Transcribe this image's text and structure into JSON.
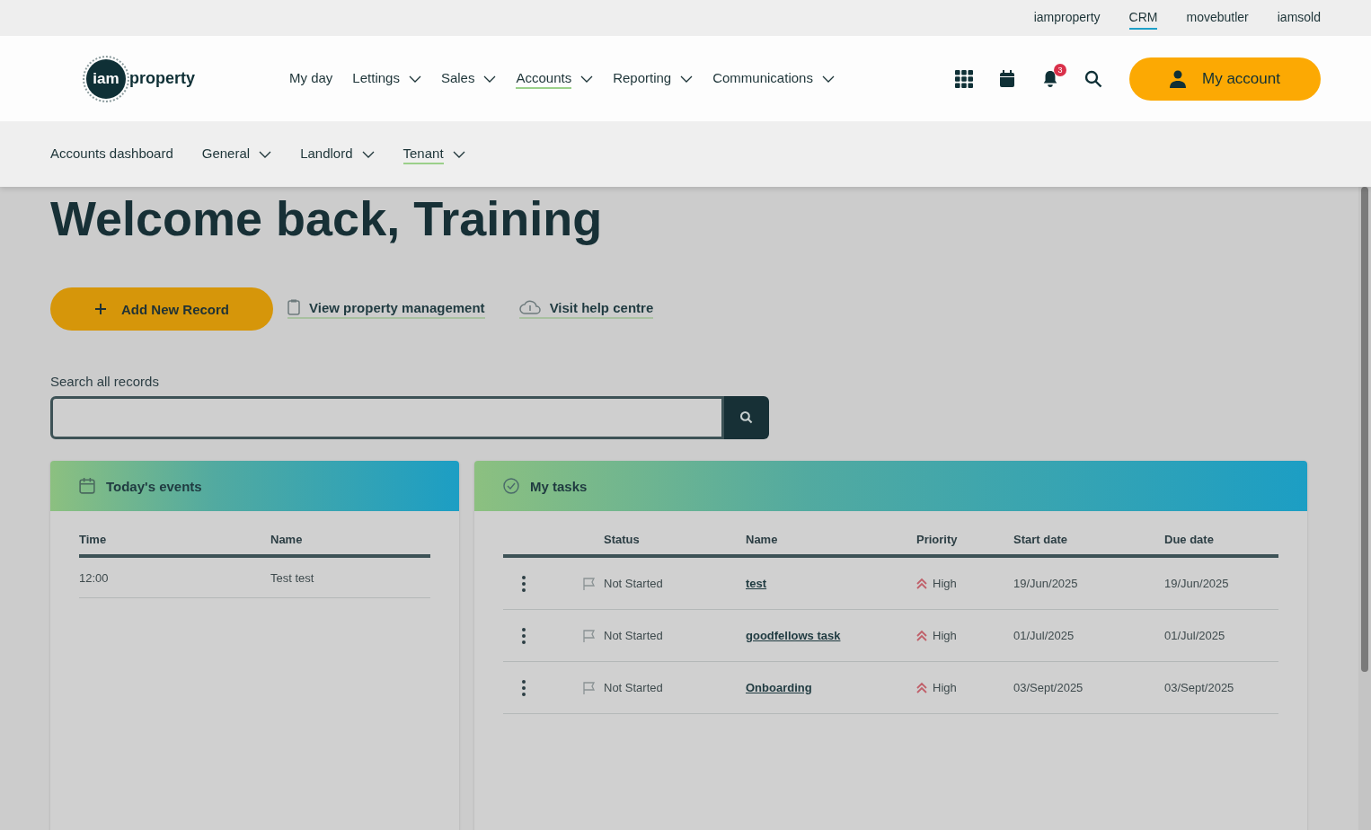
{
  "utility_links": [
    {
      "label": "iamproperty",
      "selected": false
    },
    {
      "label": "CRM",
      "selected": true
    },
    {
      "label": "movebutler",
      "selected": false
    },
    {
      "label": "iamsold",
      "selected": false
    }
  ],
  "logo": {
    "badge": "iam",
    "word": "property"
  },
  "main_nav": [
    {
      "label": "My day",
      "dropdown": false,
      "selected": false
    },
    {
      "label": "Lettings",
      "dropdown": true,
      "selected": false
    },
    {
      "label": "Sales",
      "dropdown": true,
      "selected": false
    },
    {
      "label": "Accounts",
      "dropdown": true,
      "selected": true
    },
    {
      "label": "Reporting",
      "dropdown": true,
      "selected": false
    },
    {
      "label": "Communications",
      "dropdown": true,
      "selected": false
    }
  ],
  "notification_count": "3",
  "account_button": "My account",
  "sub_nav": [
    {
      "label": "Accounts dashboard",
      "dropdown": false,
      "selected": false
    },
    {
      "label": "General",
      "dropdown": true,
      "selected": false
    },
    {
      "label": "Landlord",
      "dropdown": true,
      "selected": false
    },
    {
      "label": "Tenant",
      "dropdown": true,
      "selected": true
    }
  ],
  "heading": "Welcome back, Training",
  "add_button": "Add New Record",
  "links": [
    {
      "label": "View property management",
      "kind": "clipboard"
    },
    {
      "label": "Visit help centre",
      "kind": "help"
    }
  ],
  "search": {
    "label": "Search all records"
  },
  "events_card": {
    "title": "Today's events",
    "columns": [
      "Time",
      "Name"
    ],
    "rows": [
      {
        "time": "12:00",
        "name": "Test test"
      }
    ]
  },
  "tasks_card": {
    "title": "My tasks",
    "columns": [
      "Status",
      "Name",
      "Priority",
      "Start date",
      "Due date"
    ],
    "rows": [
      {
        "status": "Not Started",
        "name": "test",
        "priority": "High",
        "start": "19/Jun/2025",
        "due": "19/Jun/2025"
      },
      {
        "status": "Not Started",
        "name": "goodfellows task",
        "priority": "High",
        "start": "01/Jul/2025",
        "due": "01/Jul/2025"
      },
      {
        "status": "Not Started",
        "name": "Onboarding",
        "priority": "High",
        "start": "03/Sept/2025",
        "due": "03/Sept/2025"
      }
    ]
  }
}
